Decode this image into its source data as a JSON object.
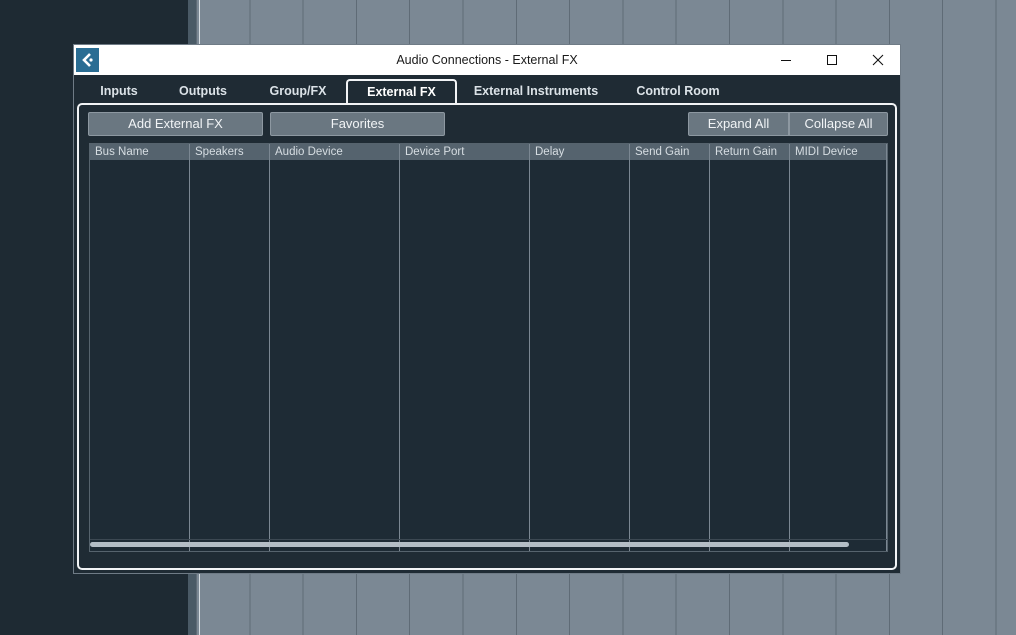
{
  "window": {
    "title": "Audio Connections - External FX"
  },
  "tabs": [
    {
      "label": "Inputs",
      "active": false
    },
    {
      "label": "Outputs",
      "active": false
    },
    {
      "label": "Group/FX",
      "active": false
    },
    {
      "label": "External FX",
      "active": true
    },
    {
      "label": "External Instruments",
      "active": false
    },
    {
      "label": "Control Room",
      "active": false
    }
  ],
  "toolbar": {
    "add_external_fx": "Add External FX",
    "favorites": "Favorites",
    "expand_all": "Expand All",
    "collapse_all": "Collapse All"
  },
  "table": {
    "columns": [
      "Bus Name",
      "Speakers",
      "Audio Device",
      "Device Port",
      "Delay",
      "Send Gain",
      "Return Gain",
      "MIDI Device"
    ],
    "rows": []
  },
  "icons": {
    "app": "cubase-logo-icon",
    "minimize": "minimize-icon",
    "maximize": "maximize-icon",
    "close": "close-icon"
  },
  "colors": {
    "background": "#1f2b34",
    "header": "#55636e",
    "button": "#6a7781",
    "accent": "#2a6d93"
  }
}
